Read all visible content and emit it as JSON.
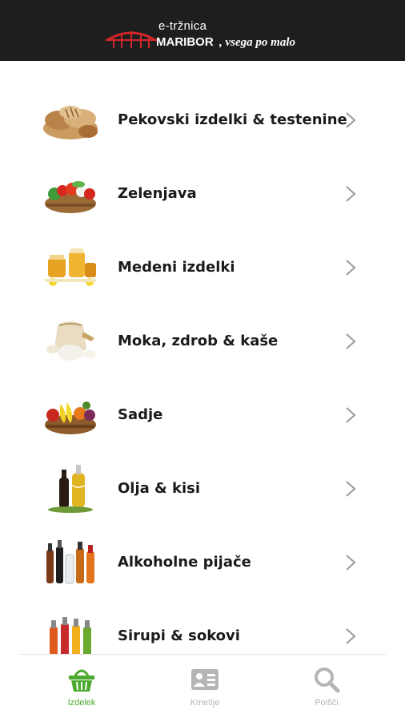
{
  "header": {
    "brand_top": "e-tržnica",
    "brand_name": "MARIBOR",
    "slogan": ", vsega po malo"
  },
  "categories": [
    {
      "label": "Pekovski izdelki & testenine",
      "icon": "bread-icon"
    },
    {
      "label": "Zelenjava",
      "icon": "vegetables-basket-icon"
    },
    {
      "label": "Medeni izdelki",
      "icon": "honey-jars-icon"
    },
    {
      "label": "Moka, zdrob & kaše",
      "icon": "flour-sack-icon"
    },
    {
      "label": "Sadje",
      "icon": "fruit-basket-icon"
    },
    {
      "label": "Olja & kisi",
      "icon": "oil-bottles-icon"
    },
    {
      "label": "Alkoholne pijače",
      "icon": "liquor-bottles-icon"
    },
    {
      "label": "Sirupi & sokovi",
      "icon": "juice-bottles-icon"
    }
  ],
  "tabs": [
    {
      "label": "Izdelek",
      "icon": "basket-icon",
      "active": true
    },
    {
      "label": "Kmetije",
      "icon": "farm-card-icon",
      "active": false
    },
    {
      "label": "Poišči",
      "icon": "search-icon",
      "active": false
    }
  ],
  "colors": {
    "header_bg": "#1e1e1e",
    "accent_active": "#4aaa2e",
    "tab_inactive": "#b5b5b5",
    "logo_red": "#d0262a",
    "chevron": "#9a9a9a"
  }
}
